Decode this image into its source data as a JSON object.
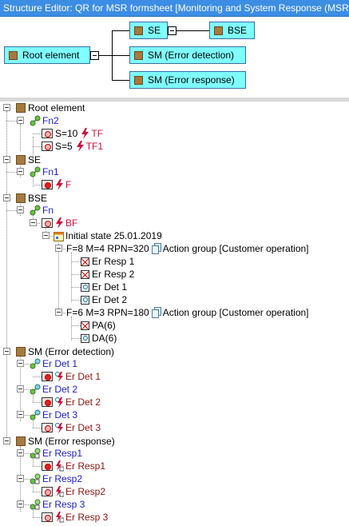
{
  "window": {
    "title": "Structure Editor: QR for MSR formsheet [Monitoring and System Response (MSR)]"
  },
  "diagram": {
    "root": "Root element",
    "se": "SE",
    "bse": "BSE",
    "sm_detect": "SM (Error detection)",
    "sm_response": "SM (Error response)"
  },
  "tree": {
    "root": {
      "label": "Root element",
      "fn": "Fn2",
      "f1": {
        "label": "S=10",
        "tag": "TF"
      },
      "f2": {
        "label": "S=5",
        "tag": "TF1"
      }
    },
    "se": {
      "label": "SE",
      "fn": "Fn1",
      "f1": {
        "tag": "F"
      }
    },
    "bse": {
      "label": "BSE",
      "fn": "Fn",
      "f1": {
        "tag": "BF"
      },
      "state": "Initial state 25.01.2019",
      "g1": {
        "label": "F=8 M=4 RPN=320",
        "action": "Action group [Customer operation]",
        "items": [
          "Er Resp 1",
          "Er Resp 2",
          "Er Det 1",
          "Er Det 2"
        ]
      },
      "g2": {
        "label": "F=6 M=3 RPN=180",
        "action": "Action group [Customer operation]",
        "items": [
          "PA(6)",
          "DA(6)"
        ]
      }
    },
    "sm_detect": {
      "label": "SM (Error detection)",
      "fns": [
        "Er Det 1",
        "Er Det 2",
        "Er Det 3"
      ],
      "fails": [
        "Er Det 1",
        "Er Det 2",
        "Er Det 3"
      ]
    },
    "sm_response": {
      "label": "SM (Error response)",
      "fns": [
        "Er Resp1",
        "Er Resp2",
        "Er Resp 3"
      ],
      "fails": [
        "Er Resp1",
        "Er Resp2",
        "Er Resp 3"
      ]
    }
  },
  "colors": {
    "titlebar": "#3c8de4",
    "box_fill": "#7fffff",
    "structure_icon": "#a57a3c",
    "fn_text": "#1a1ad0",
    "failure_text": "#d0103a"
  }
}
